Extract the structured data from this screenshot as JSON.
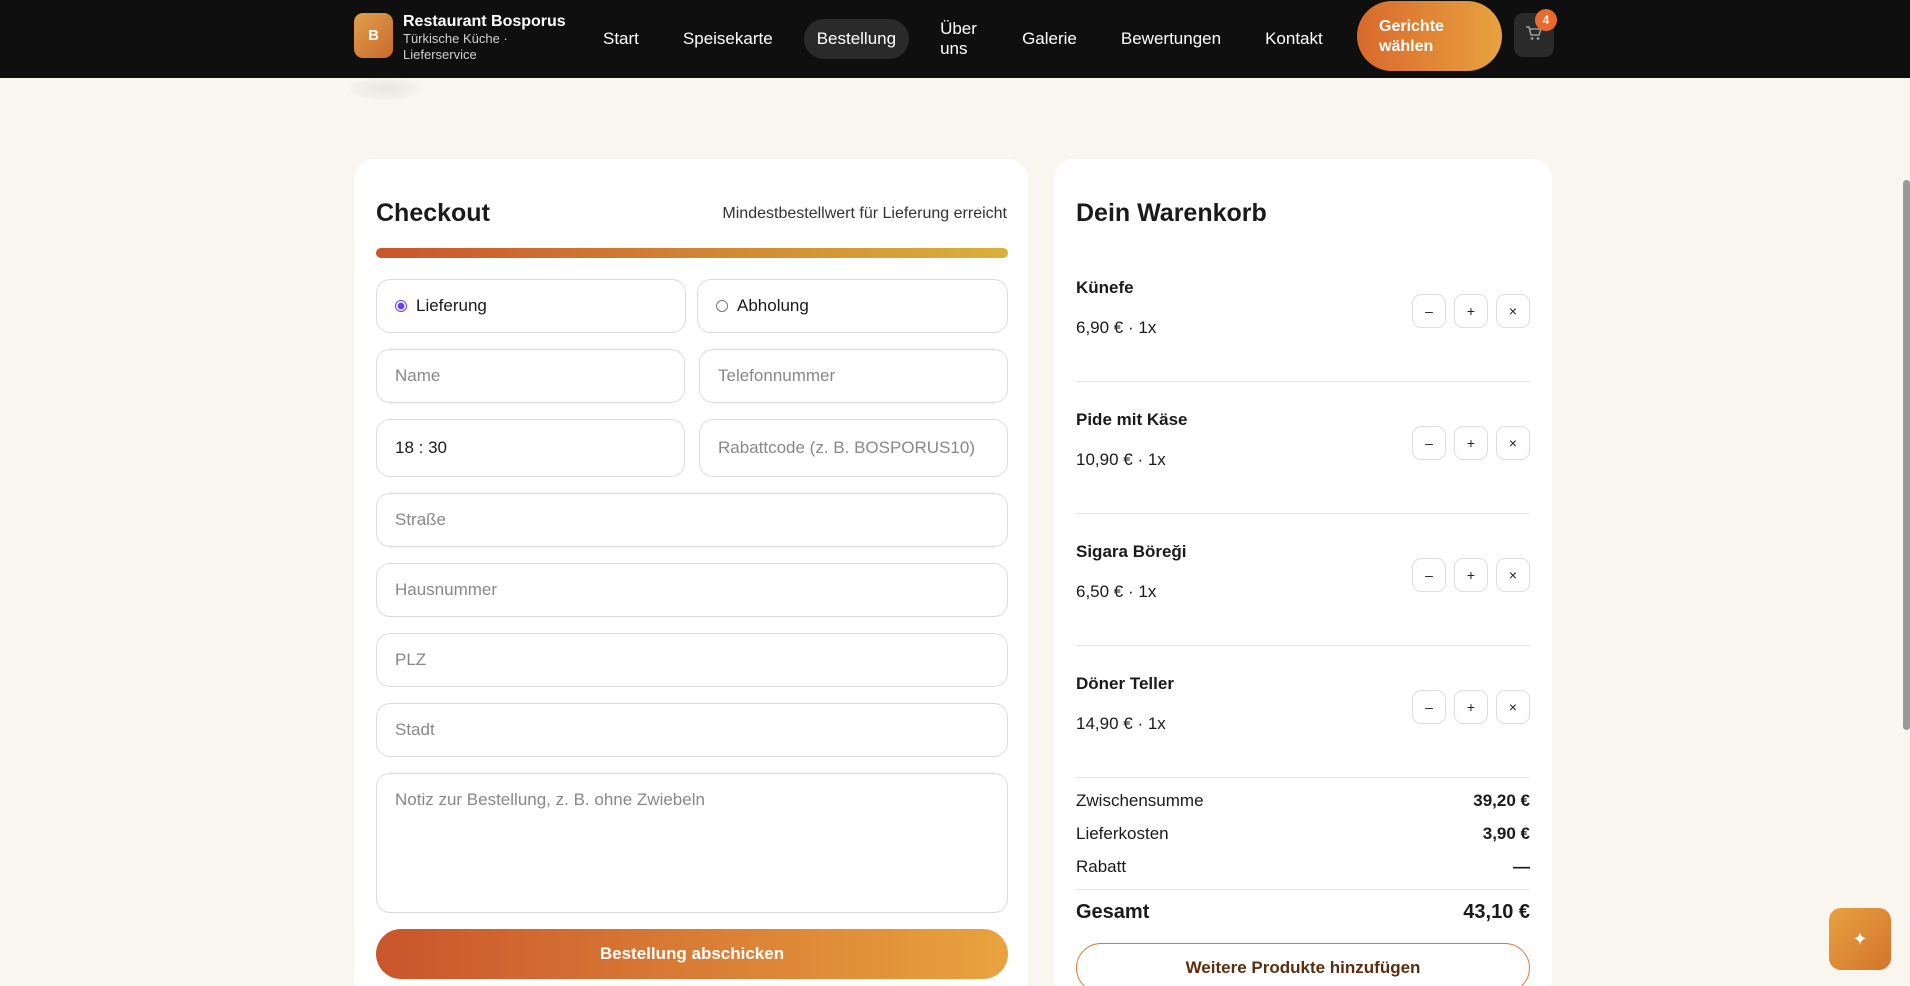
{
  "header": {
    "logo_letter": "B",
    "brand_name": "Restaurant Bosporus",
    "brand_sub": "Türkische Küche · Lieferservice",
    "nav": [
      "Start",
      "Speisekarte",
      "Bestellung",
      "Über uns",
      "Galerie",
      "Bewertungen",
      "Kontakt"
    ],
    "active_nav": "Bestellung",
    "cta_label": "Gerichte wählen",
    "cart_icon": "cart-icon",
    "cart_count": "4"
  },
  "checkout": {
    "title": "Checkout",
    "min_order_note": "Mindestbestellwert für Lieferung erreicht",
    "progress": 1.0,
    "delivery_options": [
      {
        "label": "Lieferung",
        "selected": true
      },
      {
        "label": "Abholung",
        "selected": false
      }
    ],
    "fields": {
      "name_placeholder": "Name",
      "phone_placeholder": "Telefonnummer",
      "time_value": "18 : 30",
      "coupon_placeholder": "Rabattcode (z. B. BOSPORUS10)",
      "street_placeholder": "Straße",
      "house_placeholder": "Hausnummer",
      "zip_placeholder": "PLZ",
      "city_placeholder": "Stadt",
      "note_placeholder": "Notiz zur Bestellung, z. B. ohne Zwiebeln"
    },
    "submit_label": "Bestellung abschicken"
  },
  "cart": {
    "title": "Dein Warenkorb",
    "items": [
      {
        "name": "Künefe",
        "price_line": "6,90 € · 1x"
      },
      {
        "name": "Pide mit Käse",
        "price_line": "10,90 € · 1x"
      },
      {
        "name": "Sigara Böreği",
        "price_line": "6,50 € · 1x"
      },
      {
        "name": "Döner Teller",
        "price_line": "14,90 € · 1x"
      }
    ],
    "minus": "–",
    "plus": "+",
    "remove": "×",
    "subtotal_label": "Zwischensumme",
    "subtotal_value": "39,20 €",
    "delivery_label": "Lieferkosten",
    "delivery_value": "3,90 €",
    "discount_label": "Rabatt",
    "discount_value": "—",
    "total_label": "Gesamt",
    "total_value": "43,10 €",
    "more_label": "Weitere Produkte hinzufügen"
  },
  "fab_icon": "sparkle-icon",
  "fab_glyph": "✦",
  "colors": {
    "accent": "#e8a23f",
    "accent_dark": "#c9552c",
    "header_bg": "#0f0f0f",
    "page_bg": "#f9f5ef"
  }
}
